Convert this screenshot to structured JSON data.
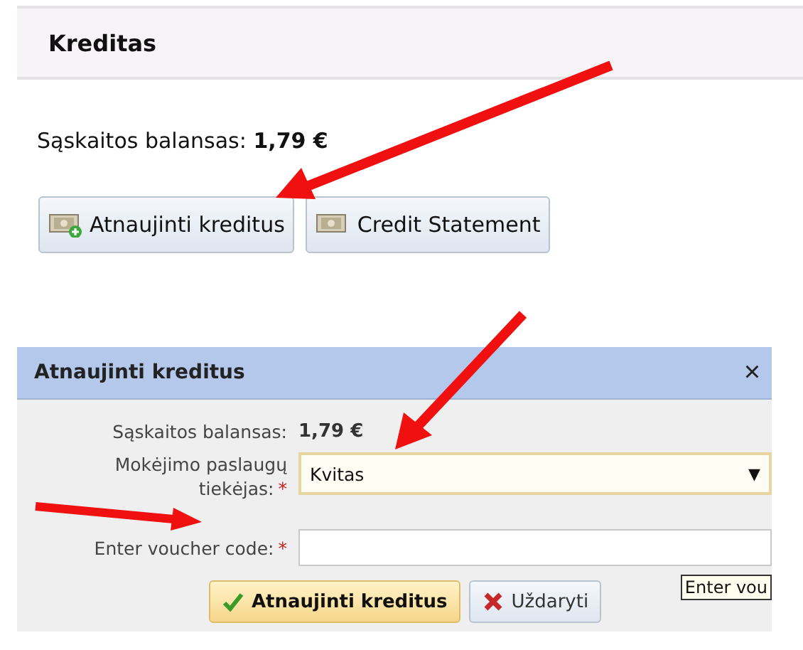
{
  "panel": {
    "title": "Kreditas",
    "balance": "Sąskaitos balansas: **1,79 €**",
    "buttons": [
      {
        "kind": "add",
        "label": "Atnaujinti kreditus"
      },
      {
        "kind": "statement",
        "label": "Credit Statement"
      }
    ]
  },
  "dialog": {
    "title": "Atnaujinti kreditus",
    "close": "×",
    "balance_label": "Sąskaitos balansas:",
    "balance_value": "1,79 €",
    "provider_label": "Mokėjimo paslaugų tiekėjas:",
    "provider_value": "Kvitas",
    "provider_required_mark": "*",
    "dropdown_caret": "▼",
    "voucher_label": "Enter voucher code:",
    "voucher_required_mark": "*",
    "voucher_tooltip": "Enter vou",
    "buttons": [
      {
        "kind": "confirm",
        "label": "Atnaujinti kreditus"
      },
      {
        "kind": "cancel",
        "label": "Uždaryti"
      }
    ]
  }
}
